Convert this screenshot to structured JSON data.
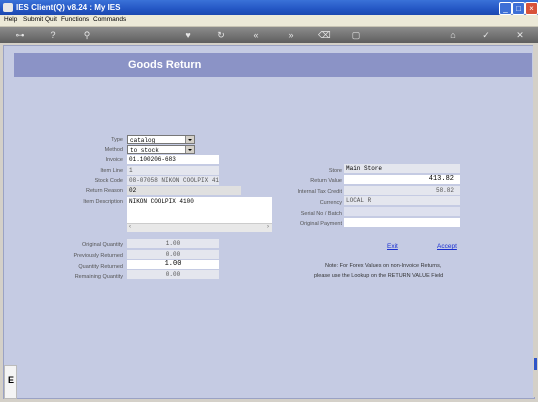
{
  "window": {
    "title": "IES Client(Q) v8.24 : My IES"
  },
  "menu": {
    "items": [
      "Help",
      "Submit",
      "Quit",
      "Functions",
      "Commands"
    ]
  },
  "page": {
    "title": "Goods Return"
  },
  "form": {
    "type_label": "Type",
    "type_value": "catalog",
    "method_label": "Method",
    "method_value": "to stock",
    "invoice_label": "Invoice",
    "invoice_value": "01.100206-683",
    "item_line_label": "Item Line",
    "item_line_value": "1",
    "stock_code_label": "Stock Code",
    "stock_code_value": "08-07058 NIKON COOLPIX 41",
    "return_reason_label": "Return Reason",
    "return_reason_value": "02",
    "item_description_label": "Item Description",
    "item_description_value": "NIKON COOLPIX 4100",
    "store_label": "Store",
    "store_value": "Main Store",
    "return_value_label": "Return Value",
    "return_value_value": "413.82",
    "internal_tax_credit_label": "Internal Tax Credit",
    "internal_tax_credit_value": "58.82",
    "currency_label": "Currency",
    "currency_value": "LOCAL R",
    "serial_batch_label": "Serial No / Batch",
    "serial_batch_value": "",
    "original_payment_label": "Original Payment",
    "original_payment_value": "",
    "original_quantity_label": "Original Quantity",
    "original_quantity_value": "1.00",
    "previously_returned_label": "Previously Returned",
    "previously_returned_value": "0.00",
    "quantity_returned_label": "Quantity Returned",
    "quantity_returned_value": "1.00",
    "remaining_quantity_label": "Remaining Quantity",
    "remaining_quantity_value": "0.00"
  },
  "actions": {
    "exit": "Exit",
    "accept": "Accept"
  },
  "note": {
    "line1": "Note: For Forex Values on non-Invoice Returns,",
    "line2": "please use the Lookup on the RETURN VALUE Field"
  },
  "toolbar": {
    "icons": [
      "key-icon",
      "help-icon",
      "search-icon",
      "heart-icon",
      "refresh-icon",
      "rewind-icon",
      "fast-forward-icon",
      "clear-icon",
      "document-icon",
      "home-icon",
      "check-icon",
      "close-icon"
    ]
  },
  "leftstrip": {
    "letter": "E"
  },
  "colors": {
    "titlebar": "#2456c4",
    "banner": "#8b93c6",
    "content": "#c5cbe3",
    "link": "#1a2fd0"
  }
}
